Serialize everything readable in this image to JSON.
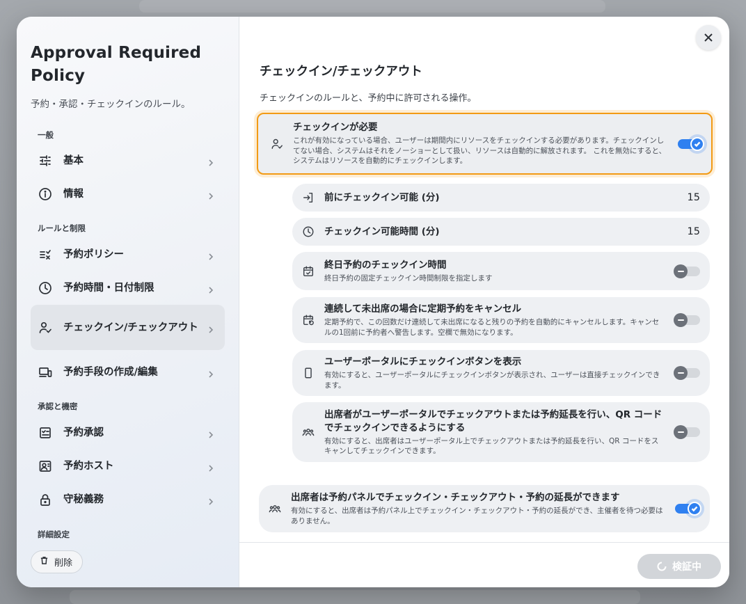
{
  "sidebar": {
    "title": "Approval Required Policy",
    "subtitle": "予約・承認・チェックインのルール。",
    "sections": {
      "general": "一般",
      "rules": "ルールと制限",
      "approval": "承認と機密",
      "advanced": "詳細設定"
    },
    "items": {
      "basic": "基本",
      "info": "情報",
      "booking_policy": "予約ポリシー",
      "time_date_limit": "予約時間・日付制限",
      "checkin_checkout": "チェックイン/チェックアウト",
      "booking_methods": "予約手段の作成/編集",
      "booking_approval": "予約承認",
      "booking_host": "予約ホスト",
      "confidentiality": "守秘義務"
    },
    "delete_label": "削除"
  },
  "main": {
    "title": "チェックイン/チェックアウト",
    "description": "チェックインのルールと、予約中に許可される操作。",
    "cards": {
      "checkin_required": {
        "title": "チェックインが必要",
        "description": "これが有効になっている場合、ユーザーは期間内にリソースをチェックインする必要があります。チェックインしてない場合、システムはそれをノーショーとして扱い、リソースは自動的に解放されます。 これを無効にすると、システムはリソースを自動的にチェックインします。",
        "enabled": true
      },
      "checkin_before": {
        "title": "前にチェックイン可能 (分)",
        "value": "15"
      },
      "checkin_window": {
        "title": "チェックイン可能時間 (分)",
        "value": "15"
      },
      "allday_checkin": {
        "title": "終日予約のチェックイン時間",
        "description": "終日予約の固定チェックイン時間制限を指定します",
        "enabled": false
      },
      "cancel_recurring": {
        "title": "連続して未出席の場合に定期予約をキャンセル",
        "description": "定期予約で、この回数だけ連続して未出席になると残りの予約を自動的にキャンセルします。キャンセルの1回前に予約者へ警告します。空欄で無効になります。",
        "enabled": false
      },
      "portal_checkin_button": {
        "title": "ユーザーポータルにチェックインボタンを表示",
        "description": "有効にすると、ユーザーポータルにチェックインボタンが表示され、ユーザーは直接チェックインできます。",
        "enabled": false
      },
      "attendee_portal": {
        "title": "出席者がユーザーポータルでチェックアウトまたは予約延長を行い、QR コードでチェックインできるようにする",
        "description": "有効にすると、出席者はユーザーポータル上でチェックアウトまたは予約延長を行い、QR コードをスキャンしてチェックインできます。",
        "enabled": false
      },
      "attendee_panel": {
        "title": "出席者は予約パネルでチェックイン・チェックアウト・予約の延長ができます",
        "description": "有効にすると、出席者は予約パネル上でチェックイン・チェックアウト・予約の延長ができ、主催者を待つ必要はありません。",
        "enabled": true
      }
    }
  },
  "footer": {
    "verify_label": "検証中"
  },
  "icons": [
    "sliders-icon",
    "info-icon",
    "list-check-icon",
    "clock-icon",
    "user-check-icon",
    "devices-icon",
    "checklist-icon",
    "host-icon",
    "lock-icon",
    "trash-icon",
    "close-icon",
    "login-icon",
    "calendar-check-icon",
    "calendar-repeat-icon",
    "phone-icon",
    "group-icon",
    "chevron-right-icon",
    "check-icon",
    "spinner-icon"
  ],
  "colors": {
    "accent": "#2f80f0",
    "highlight": "#f29a14",
    "disabled_button": "#d2d5d9"
  }
}
